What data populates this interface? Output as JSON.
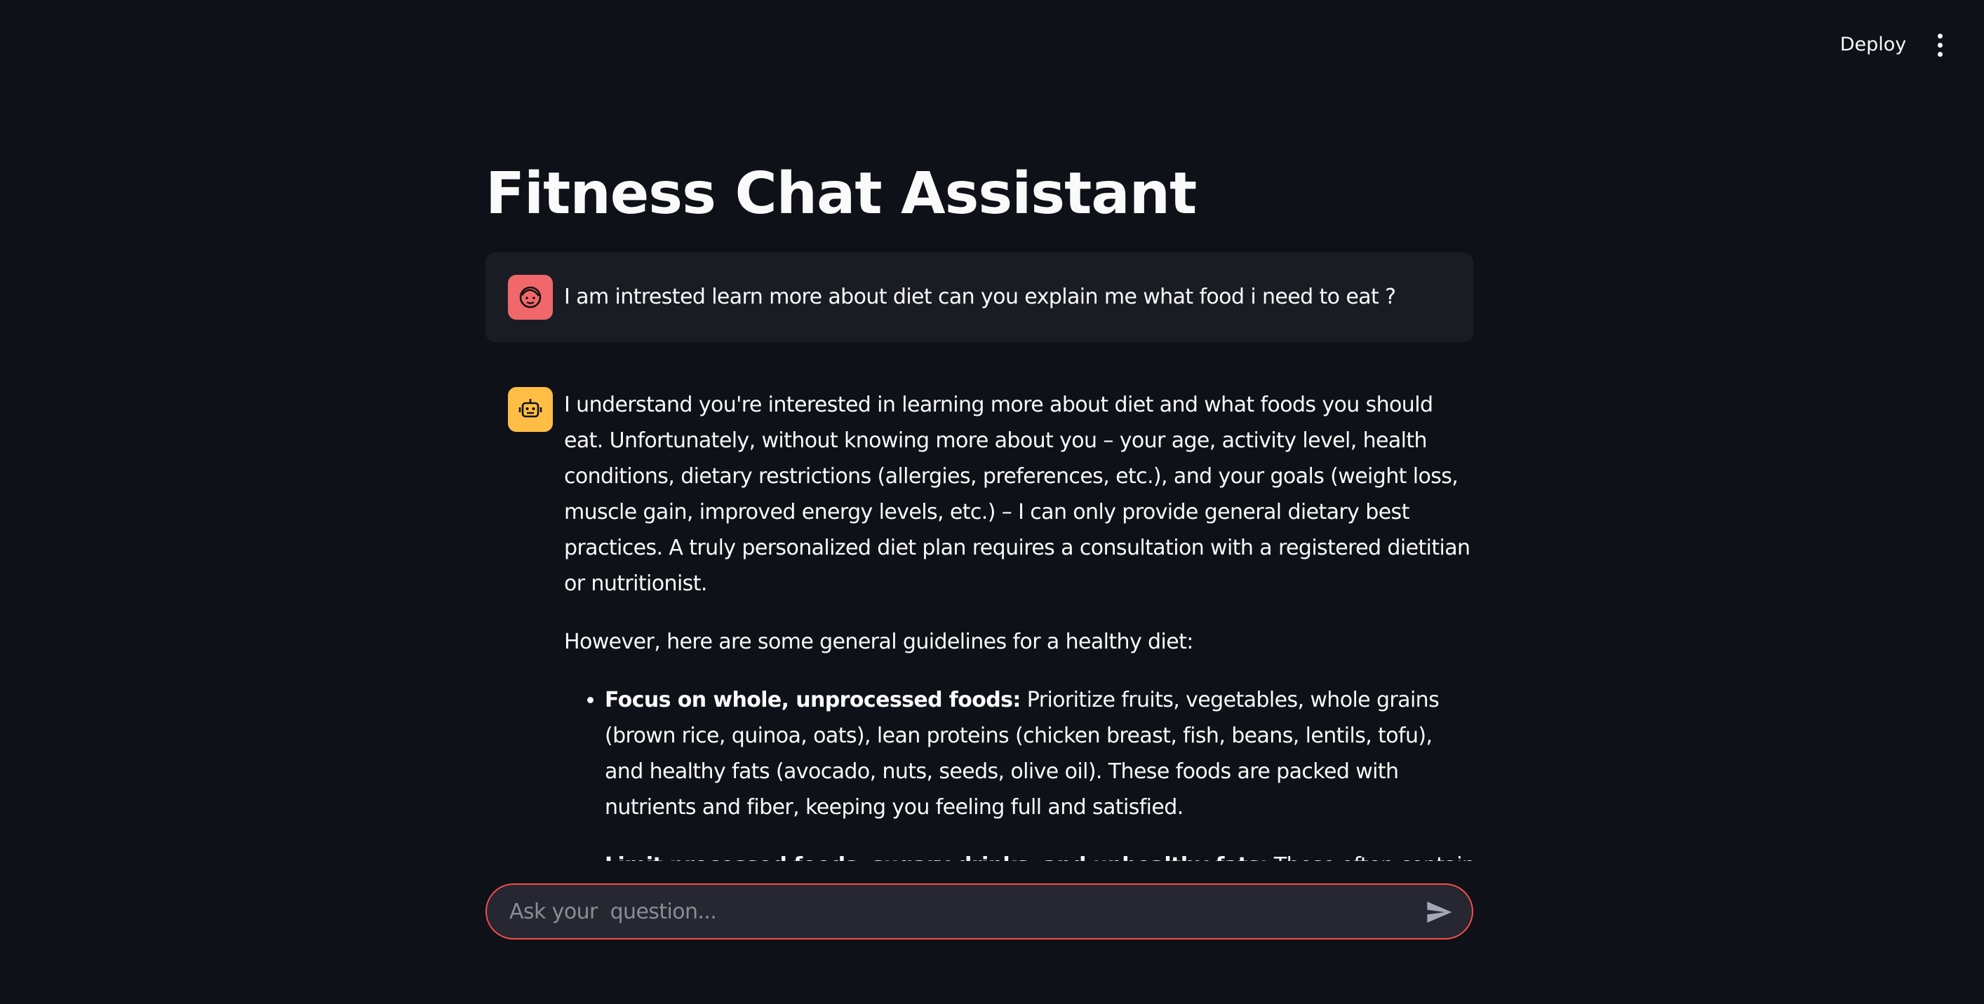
{
  "header": {
    "deploy_label": "Deploy",
    "menu_icon": "vertical-dots-icon"
  },
  "page": {
    "title": "Fitness Chat Assistant"
  },
  "messages": {
    "user": {
      "avatar_icon": "user-face-icon",
      "avatar_color": "#f0686a",
      "text": "I am intrested learn more about diet can you explain me what food i need to eat ?"
    },
    "assistant": {
      "avatar_icon": "robot-icon",
      "avatar_color": "#ffbd45",
      "paragraph_1": "I understand you're interested in learning more about diet and what foods you should eat. Unfortunately, without knowing more about you – your age, activity level, health conditions, dietary restrictions (allergies, preferences, etc.), and your goals (weight loss, muscle gain, improved energy levels, etc.) – I can only provide general dietary best practices. A truly personalized diet plan requires a consultation with a registered dietitian or nutritionist.",
      "paragraph_2": "However, here are some general guidelines for a healthy diet:",
      "bullets": [
        {
          "bold": "Focus on whole, unprocessed foods:",
          "text": " Prioritize fruits, vegetables, whole grains (brown rice, quinoa, oats), lean proteins (chicken breast, fish, beans, lentils, tofu), and healthy fats (avocado, nuts, seeds, olive oil). These foods are packed with nutrients and fiber, keeping you feeling full and satisfied."
        },
        {
          "bold": "Limit processed foods, sugary drinks, and unhealthy fats:",
          "text": " These often contain high levels of added sugar, unhealthy fats (saturated and trans fats), and sodium, which can contribute to"
        }
      ]
    }
  },
  "chat_input": {
    "placeholder": "Ask your  question...",
    "value": "",
    "send_icon": "send-icon"
  },
  "colors": {
    "background": "#0e1117",
    "accent": "#ff4b4b",
    "user_bubble": "#1a1c24",
    "input_background": "#262730"
  }
}
